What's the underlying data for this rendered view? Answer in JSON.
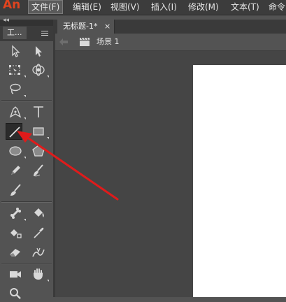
{
  "app": {
    "logo_text": "An"
  },
  "menu": {
    "items": [
      {
        "label": "文件(F)"
      },
      {
        "label": "编辑(E)"
      },
      {
        "label": "视图(V)"
      },
      {
        "label": "插入(I)"
      },
      {
        "label": "修改(M)"
      },
      {
        "label": "文本(T)"
      },
      {
        "label": "命令"
      }
    ]
  },
  "tools_panel": {
    "tab_label": "工...",
    "selected_tool": "line-tool"
  },
  "document": {
    "tab_title": "无标题-1*",
    "tab_close": "×",
    "scene_label": "场景 1"
  },
  "colors": {
    "annotation_arrow": "#e01b1b",
    "stage": "#ffffff",
    "pasteboard": "#454545",
    "logo": "#e0441f"
  }
}
